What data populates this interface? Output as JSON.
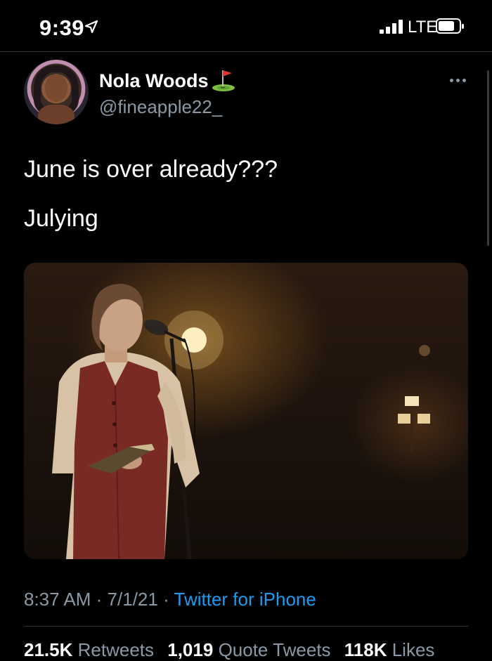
{
  "status_bar": {
    "time": "9:39",
    "carrier": "LTE",
    "icons": [
      "location-arrow-icon",
      "signal-bars-icon",
      "battery-icon"
    ]
  },
  "tweet": {
    "author": {
      "display_name": "Nola Woods",
      "handle": "@fineapple22_",
      "name_emoji": "golf-flag-icon"
    },
    "text_lines": [
      "June is over already???",
      "Julying"
    ],
    "media": {
      "type": "photo",
      "icon": "photo-image"
    },
    "meta": {
      "time": "8:37 AM",
      "date": "7/1/21",
      "separator": "·",
      "source": "Twitter for iPhone"
    },
    "stats": {
      "retweets_count": "21.5K",
      "retweets_label": "Retweets",
      "quotes_count": "1,019",
      "quotes_label": "Quote Tweets",
      "likes_count": "118K",
      "likes_label": "Likes"
    }
  },
  "colors": {
    "background": "#000000",
    "text": "#ffffff",
    "secondary_text": "#8b98a5",
    "link": "#1d9bf0",
    "divider": "#2f3336"
  }
}
